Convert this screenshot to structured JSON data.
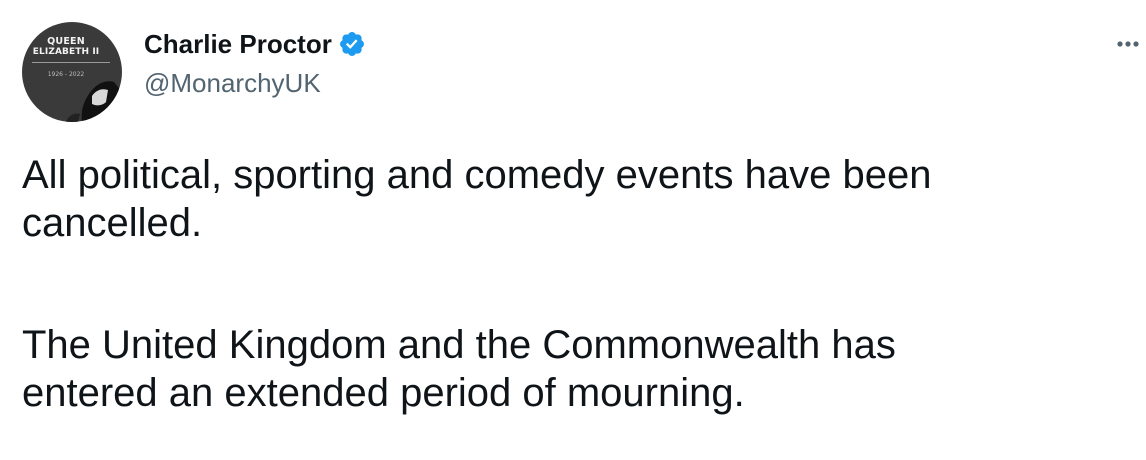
{
  "avatar": {
    "line1": "QUEEN",
    "line2": "ELIZABETH II",
    "years": "1926 - 2022"
  },
  "author": {
    "display_name": "Charlie Proctor",
    "handle": "@MonarchyUK",
    "verified": true
  },
  "tweet": {
    "paragraphs": [
      {
        "lines": [
          "All political, sporting and comedy events have been",
          "cancelled."
        ]
      },
      {
        "lines": [
          "The United Kingdom and the Commonwealth has",
          "entered an extended period of mourning."
        ]
      }
    ]
  },
  "icons": {
    "verified": "verified-badge-icon",
    "more": "more-options-icon"
  },
  "colors": {
    "text_primary": "#0f1419",
    "text_secondary": "#536471",
    "verified_blue": "#1d9bf0",
    "avatar_background": "#3a3a3a",
    "page_background": "#ffffff"
  }
}
